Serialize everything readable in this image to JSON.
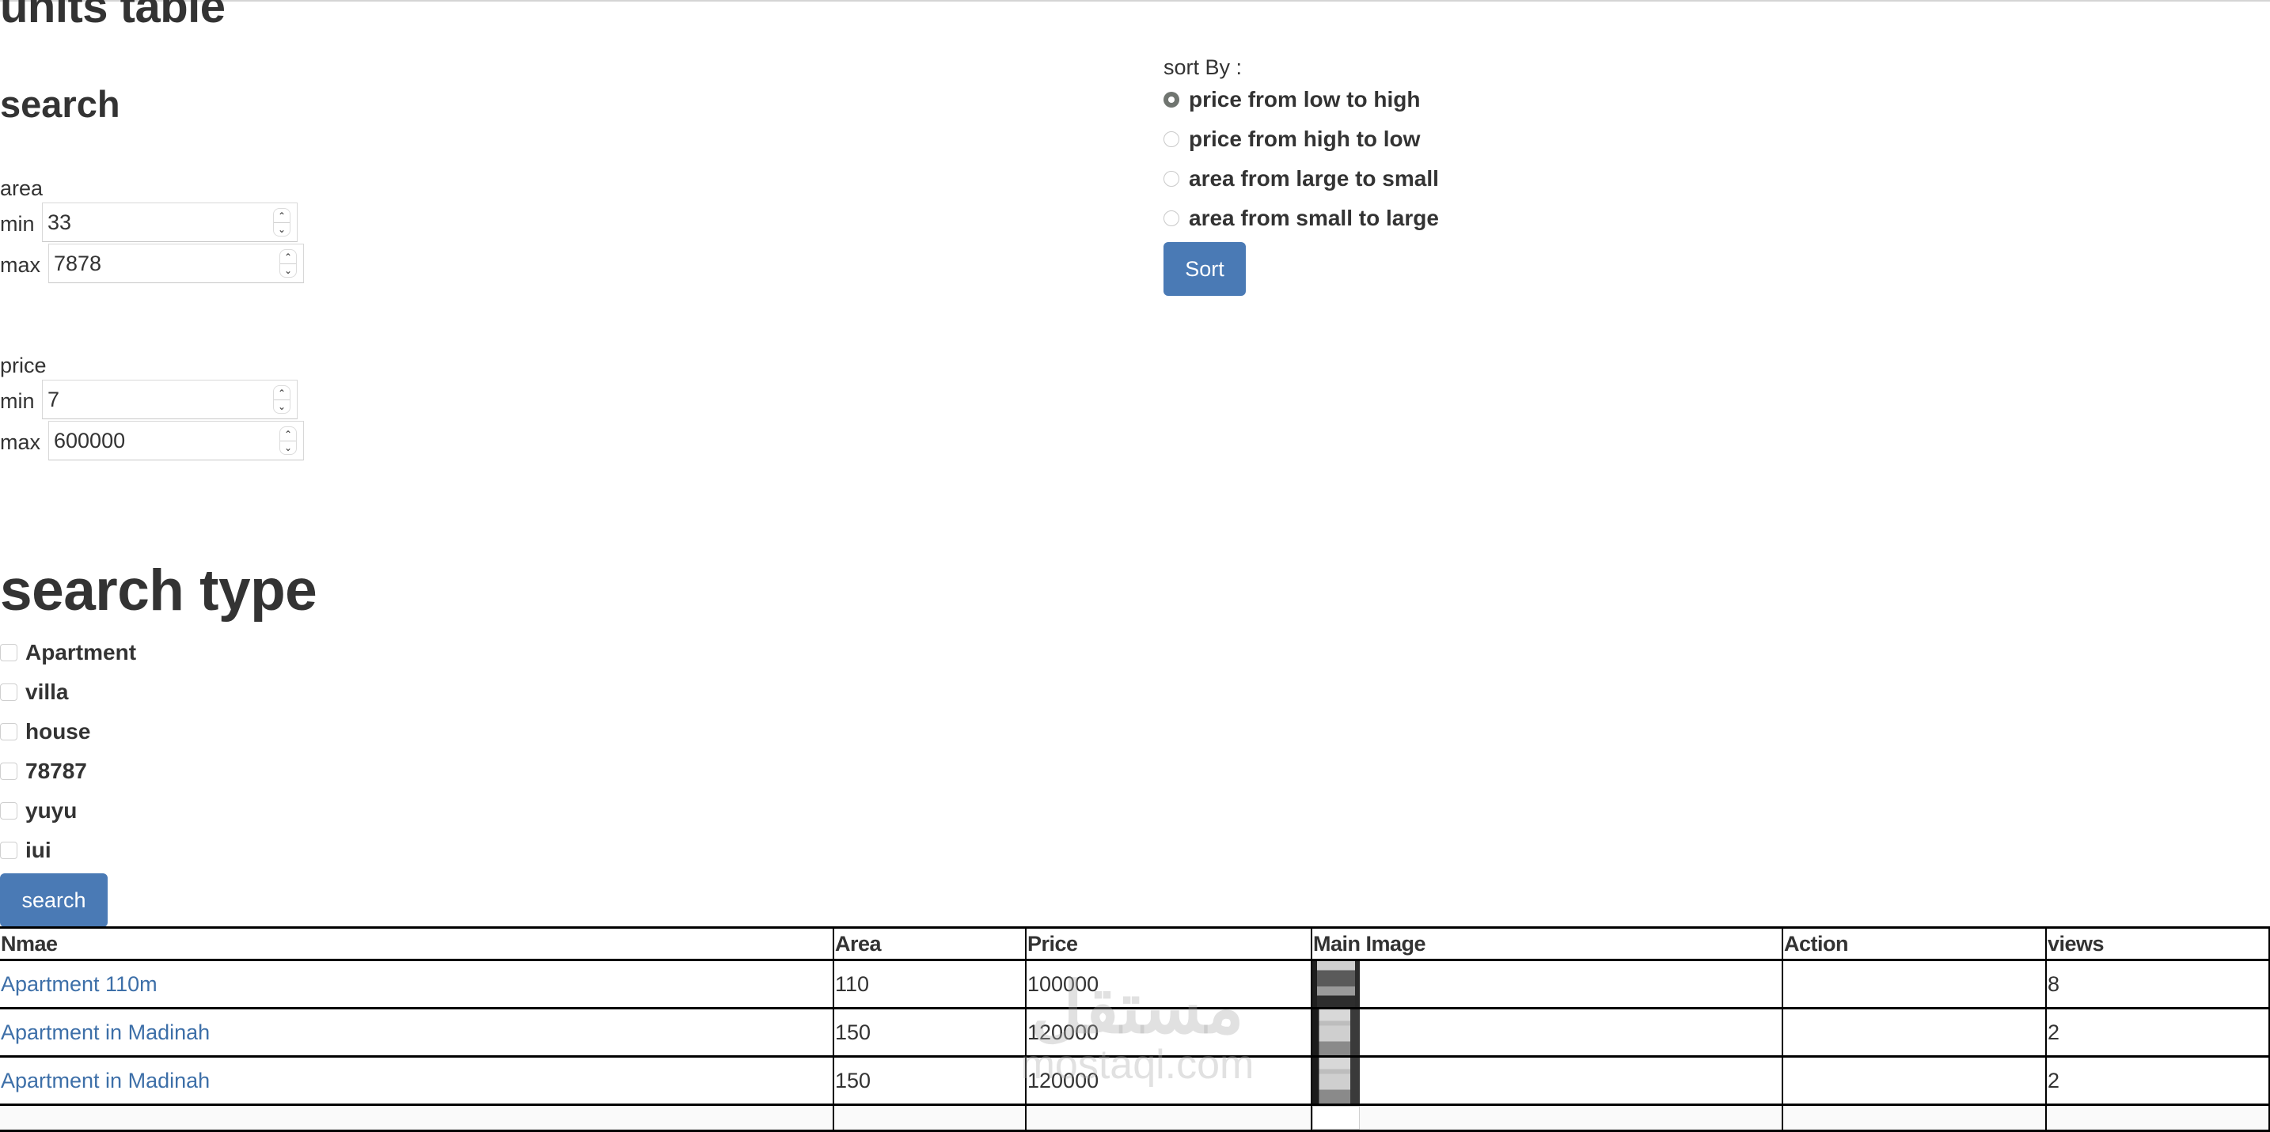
{
  "page": {
    "title": "units table",
    "search_heading": "search",
    "search_type_heading": "search type"
  },
  "area_filter": {
    "label": "area",
    "min_label": "min",
    "min_value": "33",
    "max_label": "max",
    "max_value": "7878"
  },
  "price_filter": {
    "label": "price",
    "min_label": "min",
    "min_value": "7",
    "max_label": "max",
    "max_value": "600000"
  },
  "sort": {
    "label": "sort By :",
    "options": [
      {
        "label": "price from low to high",
        "selected": true
      },
      {
        "label": "price from high to low",
        "selected": false
      },
      {
        "label": "area from large to small",
        "selected": false
      },
      {
        "label": "area from small to large",
        "selected": false
      }
    ],
    "button_label": "Sort"
  },
  "types": {
    "options": [
      {
        "label": "Apartment",
        "checked": false
      },
      {
        "label": "villa",
        "checked": false
      },
      {
        "label": "house",
        "checked": false
      },
      {
        "label": "78787",
        "checked": false
      },
      {
        "label": "yuyu",
        "checked": false
      },
      {
        "label": "iui",
        "checked": false
      }
    ],
    "search_button_label": "search"
  },
  "table": {
    "headers": [
      "Nmae",
      "Area",
      "Price",
      "Main Image",
      "Action",
      "views"
    ],
    "rows": [
      {
        "name": "Apartment 110m",
        "area": "110",
        "price": "100000",
        "image": "apartment-photo",
        "action": "",
        "views": "8"
      },
      {
        "name": "Apartment in Madinah",
        "area": "150",
        "price": "120000",
        "image": "apartment-photo",
        "action": "",
        "views": "2"
      },
      {
        "name": "Apartment in Madinah",
        "area": "150",
        "price": "120000",
        "image": "apartment-photo",
        "action": "",
        "views": "2"
      }
    ]
  },
  "watermark": {
    "arabic": "مستقل",
    "latin": "mostaql.com"
  },
  "colors": {
    "primary_button": "#4a7ab5",
    "link": "#3d6fa8",
    "text": "#333333"
  }
}
